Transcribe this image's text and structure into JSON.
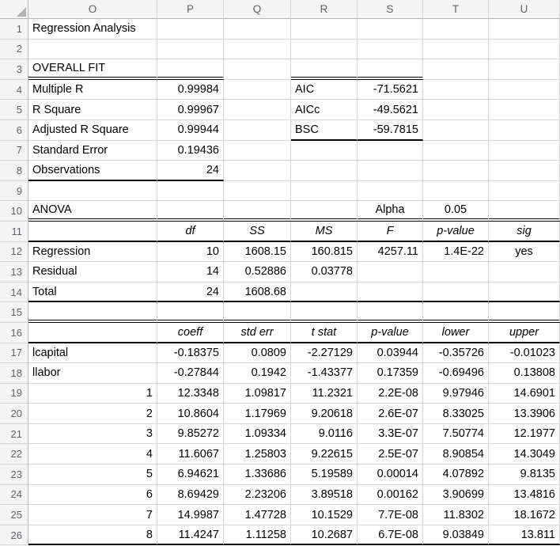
{
  "app": "spreadsheet",
  "title_cell": "Regression Analysis",
  "colors": {
    "gridline": "#d6d6d6",
    "header_bg": "#f4f4f4",
    "header_text": "#5f6368",
    "rule": "#000000",
    "cell_text": "#000000"
  },
  "columns": [
    "O",
    "P",
    "Q",
    "R",
    "S",
    "T",
    "U"
  ],
  "rows": [
    {
      "n": "1",
      "cells": [
        {
          "c": "O",
          "t": "Regression Analysis",
          "a": "l"
        }
      ]
    },
    {
      "n": "2",
      "cells": []
    },
    {
      "n": "3",
      "cells": [
        {
          "c": "O",
          "t": "OVERALL FIT",
          "a": "l"
        }
      ],
      "borders": [
        {
          "type": "double",
          "from": "O",
          "to": "P"
        },
        {
          "type": "double",
          "from": "R",
          "to": "S"
        }
      ]
    },
    {
      "n": "4",
      "cells": [
        {
          "c": "O",
          "t": "Multiple R",
          "a": "l"
        },
        {
          "c": "P",
          "t": "0.99984",
          "a": "r"
        },
        {
          "c": "R",
          "t": "AIC",
          "a": "l"
        },
        {
          "c": "S",
          "t": "-71.5621",
          "a": "r"
        }
      ]
    },
    {
      "n": "5",
      "cells": [
        {
          "c": "O",
          "t": "R Square",
          "a": "l"
        },
        {
          "c": "P",
          "t": "0.99967",
          "a": "r"
        },
        {
          "c": "R",
          "t": "AICc",
          "a": "l"
        },
        {
          "c": "S",
          "t": "-49.5621",
          "a": "r"
        }
      ]
    },
    {
      "n": "6",
      "cells": [
        {
          "c": "O",
          "t": "Adjusted R Square",
          "a": "l"
        },
        {
          "c": "P",
          "t": "0.99944",
          "a": "r"
        },
        {
          "c": "R",
          "t": "BSC",
          "a": "l"
        },
        {
          "c": "S",
          "t": "-59.7815",
          "a": "r"
        }
      ],
      "borders": [
        {
          "type": "single",
          "from": "R",
          "to": "S"
        }
      ]
    },
    {
      "n": "7",
      "cells": [
        {
          "c": "O",
          "t": "Standard Error",
          "a": "l"
        },
        {
          "c": "P",
          "t": "0.19436",
          "a": "r"
        }
      ]
    },
    {
      "n": "8",
      "cells": [
        {
          "c": "O",
          "t": "Observations",
          "a": "l"
        },
        {
          "c": "P",
          "t": "24",
          "a": "r"
        }
      ],
      "borders": [
        {
          "type": "single",
          "from": "O",
          "to": "P"
        }
      ]
    },
    {
      "n": "9",
      "cells": []
    },
    {
      "n": "10",
      "cells": [
        {
          "c": "O",
          "t": "ANOVA",
          "a": "l"
        },
        {
          "c": "S",
          "t": "Alpha",
          "a": "c"
        },
        {
          "c": "T",
          "t": "0.05",
          "a": "c"
        }
      ],
      "borders": [
        {
          "type": "double",
          "from": "O",
          "to": "U"
        }
      ]
    },
    {
      "n": "11",
      "cells": [
        {
          "c": "P",
          "t": "df",
          "a": "c",
          "i": true
        },
        {
          "c": "Q",
          "t": "SS",
          "a": "c",
          "i": true
        },
        {
          "c": "R",
          "t": "MS",
          "a": "c",
          "i": true
        },
        {
          "c": "S",
          "t": "F",
          "a": "c",
          "i": true
        },
        {
          "c": "T",
          "t": "p-value",
          "a": "c",
          "i": true
        },
        {
          "c": "U",
          "t": "sig",
          "a": "c",
          "i": true
        }
      ],
      "borders": [
        {
          "type": "single",
          "from": "O",
          "to": "U"
        }
      ]
    },
    {
      "n": "12",
      "cells": [
        {
          "c": "O",
          "t": "Regression",
          "a": "l"
        },
        {
          "c": "P",
          "t": "10",
          "a": "r"
        },
        {
          "c": "Q",
          "t": "1608.15",
          "a": "r"
        },
        {
          "c": "R",
          "t": "160.815",
          "a": "r"
        },
        {
          "c": "S",
          "t": "4257.11",
          "a": "r"
        },
        {
          "c": "T",
          "t": "1.4E-22",
          "a": "r"
        },
        {
          "c": "U",
          "t": "yes",
          "a": "c"
        }
      ]
    },
    {
      "n": "13",
      "cells": [
        {
          "c": "O",
          "t": "Residual",
          "a": "l"
        },
        {
          "c": "P",
          "t": "14",
          "a": "r"
        },
        {
          "c": "Q",
          "t": "0.52886",
          "a": "r"
        },
        {
          "c": "R",
          "t": "0.03778",
          "a": "r"
        }
      ]
    },
    {
      "n": "14",
      "cells": [
        {
          "c": "O",
          "t": "Total",
          "a": "l"
        },
        {
          "c": "P",
          "t": "24",
          "a": "r"
        },
        {
          "c": "Q",
          "t": "1608.68",
          "a": "r"
        }
      ],
      "borders": [
        {
          "type": "single",
          "from": "O",
          "to": "U"
        }
      ]
    },
    {
      "n": "15",
      "cells": [],
      "borders": [
        {
          "type": "double",
          "from": "O",
          "to": "U"
        }
      ]
    },
    {
      "n": "16",
      "cells": [
        {
          "c": "P",
          "t": "coeff",
          "a": "c",
          "i": true
        },
        {
          "c": "Q",
          "t": "std err",
          "a": "c",
          "i": true
        },
        {
          "c": "R",
          "t": "t stat",
          "a": "c",
          "i": true
        },
        {
          "c": "S",
          "t": "p-value",
          "a": "c",
          "i": true
        },
        {
          "c": "T",
          "t": "lower",
          "a": "c",
          "i": true
        },
        {
          "c": "U",
          "t": "upper",
          "a": "c",
          "i": true
        }
      ],
      "borders": [
        {
          "type": "single",
          "from": "O",
          "to": "U"
        }
      ]
    },
    {
      "n": "17",
      "cells": [
        {
          "c": "O",
          "t": "lcapital",
          "a": "l"
        },
        {
          "c": "P",
          "t": "-0.18375",
          "a": "r"
        },
        {
          "c": "Q",
          "t": "0.0809",
          "a": "r"
        },
        {
          "c": "R",
          "t": "-2.27129",
          "a": "r"
        },
        {
          "c": "S",
          "t": "0.03944",
          "a": "r"
        },
        {
          "c": "T",
          "t": "-0.35726",
          "a": "r"
        },
        {
          "c": "U",
          "t": "-0.01023",
          "a": "r"
        }
      ]
    },
    {
      "n": "18",
      "cells": [
        {
          "c": "O",
          "t": "llabor",
          "a": "l"
        },
        {
          "c": "P",
          "t": "-0.27844",
          "a": "r"
        },
        {
          "c": "Q",
          "t": "0.1942",
          "a": "r"
        },
        {
          "c": "R",
          "t": "-1.43377",
          "a": "r"
        },
        {
          "c": "S",
          "t": "0.17359",
          "a": "r"
        },
        {
          "c": "T",
          "t": "-0.69496",
          "a": "r"
        },
        {
          "c": "U",
          "t": "0.13808",
          "a": "r"
        }
      ]
    },
    {
      "n": "19",
      "cells": [
        {
          "c": "O",
          "t": "1",
          "a": "r"
        },
        {
          "c": "P",
          "t": "12.3348",
          "a": "r"
        },
        {
          "c": "Q",
          "t": "1.09817",
          "a": "r"
        },
        {
          "c": "R",
          "t": "11.2321",
          "a": "r"
        },
        {
          "c": "S",
          "t": "2.2E-08",
          "a": "r"
        },
        {
          "c": "T",
          "t": "9.97946",
          "a": "r"
        },
        {
          "c": "U",
          "t": "14.6901",
          "a": "r"
        }
      ]
    },
    {
      "n": "20",
      "cells": [
        {
          "c": "O",
          "t": "2",
          "a": "r"
        },
        {
          "c": "P",
          "t": "10.8604",
          "a": "r"
        },
        {
          "c": "Q",
          "t": "1.17969",
          "a": "r"
        },
        {
          "c": "R",
          "t": "9.20618",
          "a": "r"
        },
        {
          "c": "S",
          "t": "2.6E-07",
          "a": "r"
        },
        {
          "c": "T",
          "t": "8.33025",
          "a": "r"
        },
        {
          "c": "U",
          "t": "13.3906",
          "a": "r"
        }
      ]
    },
    {
      "n": "21",
      "cells": [
        {
          "c": "O",
          "t": "3",
          "a": "r"
        },
        {
          "c": "P",
          "t": "9.85272",
          "a": "r"
        },
        {
          "c": "Q",
          "t": "1.09334",
          "a": "r"
        },
        {
          "c": "R",
          "t": "9.0116",
          "a": "r"
        },
        {
          "c": "S",
          "t": "3.3E-07",
          "a": "r"
        },
        {
          "c": "T",
          "t": "7.50774",
          "a": "r"
        },
        {
          "c": "U",
          "t": "12.1977",
          "a": "r"
        }
      ]
    },
    {
      "n": "22",
      "cells": [
        {
          "c": "O",
          "t": "4",
          "a": "r"
        },
        {
          "c": "P",
          "t": "11.6067",
          "a": "r"
        },
        {
          "c": "Q",
          "t": "1.25803",
          "a": "r"
        },
        {
          "c": "R",
          "t": "9.22615",
          "a": "r"
        },
        {
          "c": "S",
          "t": "2.5E-07",
          "a": "r"
        },
        {
          "c": "T",
          "t": "8.90854",
          "a": "r"
        },
        {
          "c": "U",
          "t": "14.3049",
          "a": "r"
        }
      ]
    },
    {
      "n": "23",
      "cells": [
        {
          "c": "O",
          "t": "5",
          "a": "r"
        },
        {
          "c": "P",
          "t": "6.94621",
          "a": "r"
        },
        {
          "c": "Q",
          "t": "1.33686",
          "a": "r"
        },
        {
          "c": "R",
          "t": "5.19589",
          "a": "r"
        },
        {
          "c": "S",
          "t": "0.00014",
          "a": "r"
        },
        {
          "c": "T",
          "t": "4.07892",
          "a": "r"
        },
        {
          "c": "U",
          "t": "9.8135",
          "a": "r"
        }
      ]
    },
    {
      "n": "24",
      "cells": [
        {
          "c": "O",
          "t": "6",
          "a": "r"
        },
        {
          "c": "P",
          "t": "8.69429",
          "a": "r"
        },
        {
          "c": "Q",
          "t": "2.23206",
          "a": "r"
        },
        {
          "c": "R",
          "t": "3.89518",
          "a": "r"
        },
        {
          "c": "S",
          "t": "0.00162",
          "a": "r"
        },
        {
          "c": "T",
          "t": "3.90699",
          "a": "r"
        },
        {
          "c": "U",
          "t": "13.4816",
          "a": "r"
        }
      ]
    },
    {
      "n": "25",
      "cells": [
        {
          "c": "O",
          "t": "7",
          "a": "r"
        },
        {
          "c": "P",
          "t": "14.9987",
          "a": "r"
        },
        {
          "c": "Q",
          "t": "1.47728",
          "a": "r"
        },
        {
          "c": "R",
          "t": "10.1529",
          "a": "r"
        },
        {
          "c": "S",
          "t": "7.7E-08",
          "a": "r"
        },
        {
          "c": "T",
          "t": "11.8302",
          "a": "r"
        },
        {
          "c": "U",
          "t": "18.1672",
          "a": "r"
        }
      ]
    },
    {
      "n": "26",
      "cells": [
        {
          "c": "O",
          "t": "8",
          "a": "r"
        },
        {
          "c": "P",
          "t": "11.4247",
          "a": "r"
        },
        {
          "c": "Q",
          "t": "1.11258",
          "a": "r"
        },
        {
          "c": "R",
          "t": "10.2687",
          "a": "r"
        },
        {
          "c": "S",
          "t": "6.7E-08",
          "a": "r"
        },
        {
          "c": "T",
          "t": "9.03849",
          "a": "r"
        },
        {
          "c": "U",
          "t": "13.811",
          "a": "r"
        }
      ],
      "borders": [
        {
          "type": "single",
          "from": "O",
          "to": "U"
        }
      ]
    }
  ]
}
